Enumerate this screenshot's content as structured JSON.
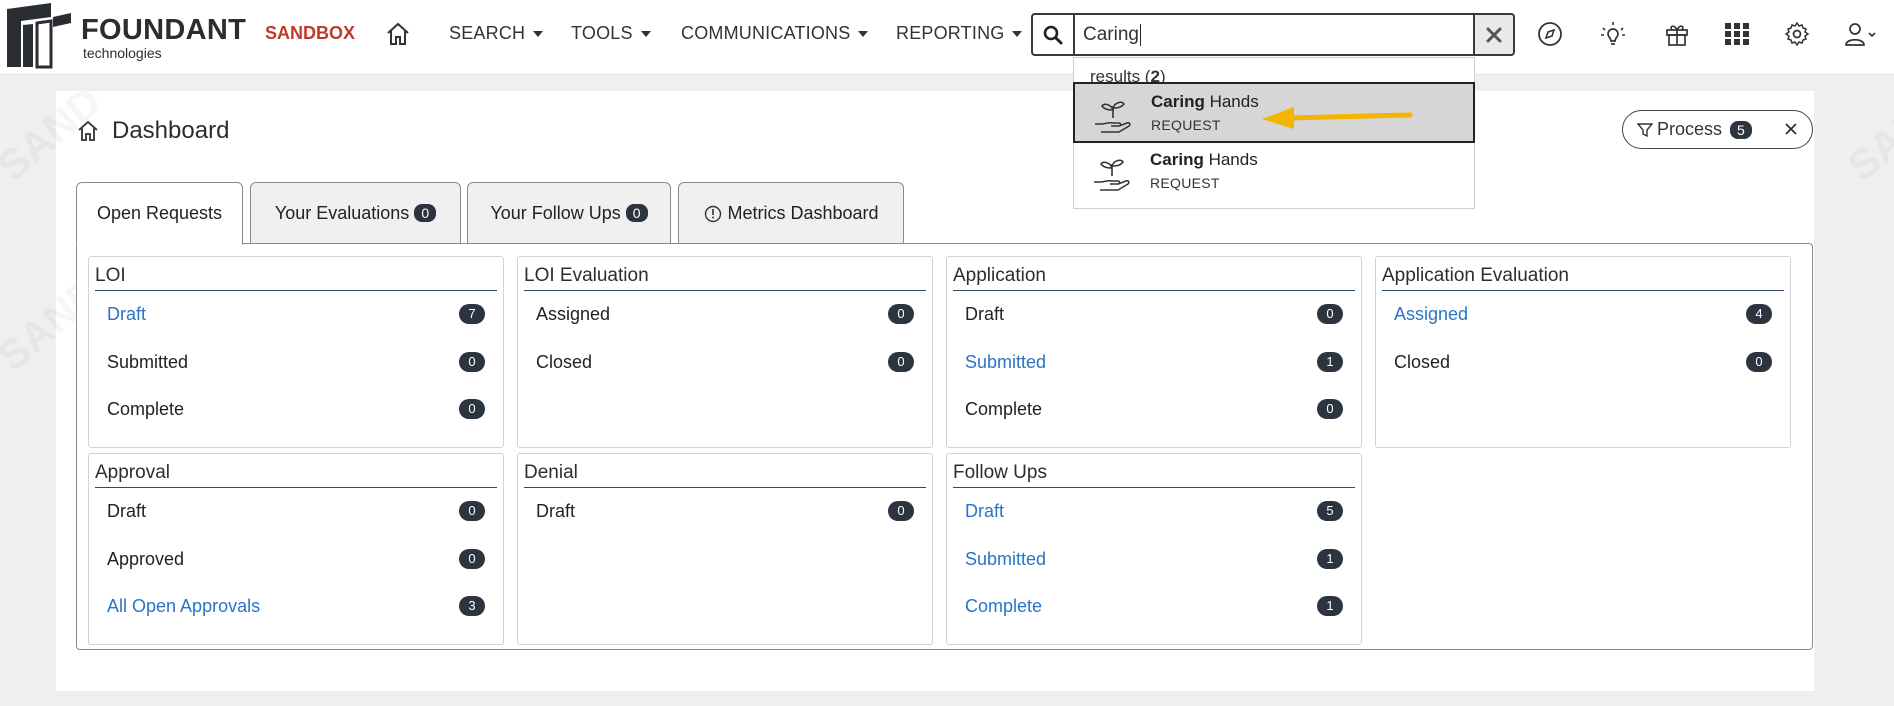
{
  "brand": {
    "name": "FOUNDANT",
    "tagline": "technologies",
    "environment": "SANDBOX"
  },
  "nav": {
    "items": [
      {
        "label": "SEARCH"
      },
      {
        "label": "TOOLS"
      },
      {
        "label": "COMMUNICATIONS"
      },
      {
        "label": "REPORTING"
      }
    ]
  },
  "search": {
    "value": "Caring",
    "results_label": "results (",
    "results_count": "2",
    "results_close": ")",
    "results": [
      {
        "bold": "Caring",
        "rest": " Hands",
        "kind": "REQUEST"
      },
      {
        "bold": "Caring",
        "rest": " Hands",
        "kind": "REQUEST"
      }
    ]
  },
  "dashboard": {
    "title": "Dashboard",
    "process_label": "Process",
    "process_count": "5"
  },
  "tabs": [
    {
      "label": "Open Requests",
      "count": null
    },
    {
      "label": "Your Evaluations",
      "count": "0"
    },
    {
      "label": "Your Follow Ups",
      "count": "0"
    },
    {
      "label": "Metrics Dashboard",
      "count": null
    }
  ],
  "cards": [
    {
      "title": "LOI",
      "rows": [
        {
          "label": "Draft",
          "count": "7",
          "link": true
        },
        {
          "label": "Submitted",
          "count": "0",
          "link": false
        },
        {
          "label": "Complete",
          "count": "0",
          "link": false
        }
      ]
    },
    {
      "title": "LOI Evaluation",
      "rows": [
        {
          "label": "Assigned",
          "count": "0",
          "link": false
        },
        {
          "label": "Closed",
          "count": "0",
          "link": false
        }
      ]
    },
    {
      "title": "Application",
      "rows": [
        {
          "label": "Draft",
          "count": "0",
          "link": false
        },
        {
          "label": "Submitted",
          "count": "1",
          "link": true
        },
        {
          "label": "Complete",
          "count": "0",
          "link": false
        }
      ]
    },
    {
      "title": "Application Evaluation",
      "rows": [
        {
          "label": "Assigned",
          "count": "4",
          "link": true
        },
        {
          "label": "Closed",
          "count": "0",
          "link": false
        }
      ]
    },
    {
      "title": "Approval",
      "rows": [
        {
          "label": "Draft",
          "count": "0",
          "link": false
        },
        {
          "label": "Approved",
          "count": "0",
          "link": false
        },
        {
          "label": "All Open Approvals",
          "count": "3",
          "link": true
        }
      ]
    },
    {
      "title": "Denial",
      "rows": [
        {
          "label": "Draft",
          "count": "0",
          "link": false
        }
      ]
    },
    {
      "title": "Follow Ups",
      "rows": [
        {
          "label": "Draft",
          "count": "5",
          "link": true
        },
        {
          "label": "Submitted",
          "count": "1",
          "link": true
        },
        {
          "label": "Complete",
          "count": "1",
          "link": true
        }
      ]
    }
  ],
  "colors": {
    "link": "#2a74c6",
    "badge": "#2c3440",
    "sandbox": "#c0392b",
    "arrow": "#f5b400"
  },
  "icons": [
    "home-icon",
    "search-icon",
    "clear-icon",
    "compass-icon",
    "lightbulb-icon",
    "gift-icon",
    "apps-grid-icon",
    "gear-icon",
    "user-icon",
    "plant-hand-icon",
    "filter-icon",
    "close-icon",
    "info-gauge-icon"
  ]
}
